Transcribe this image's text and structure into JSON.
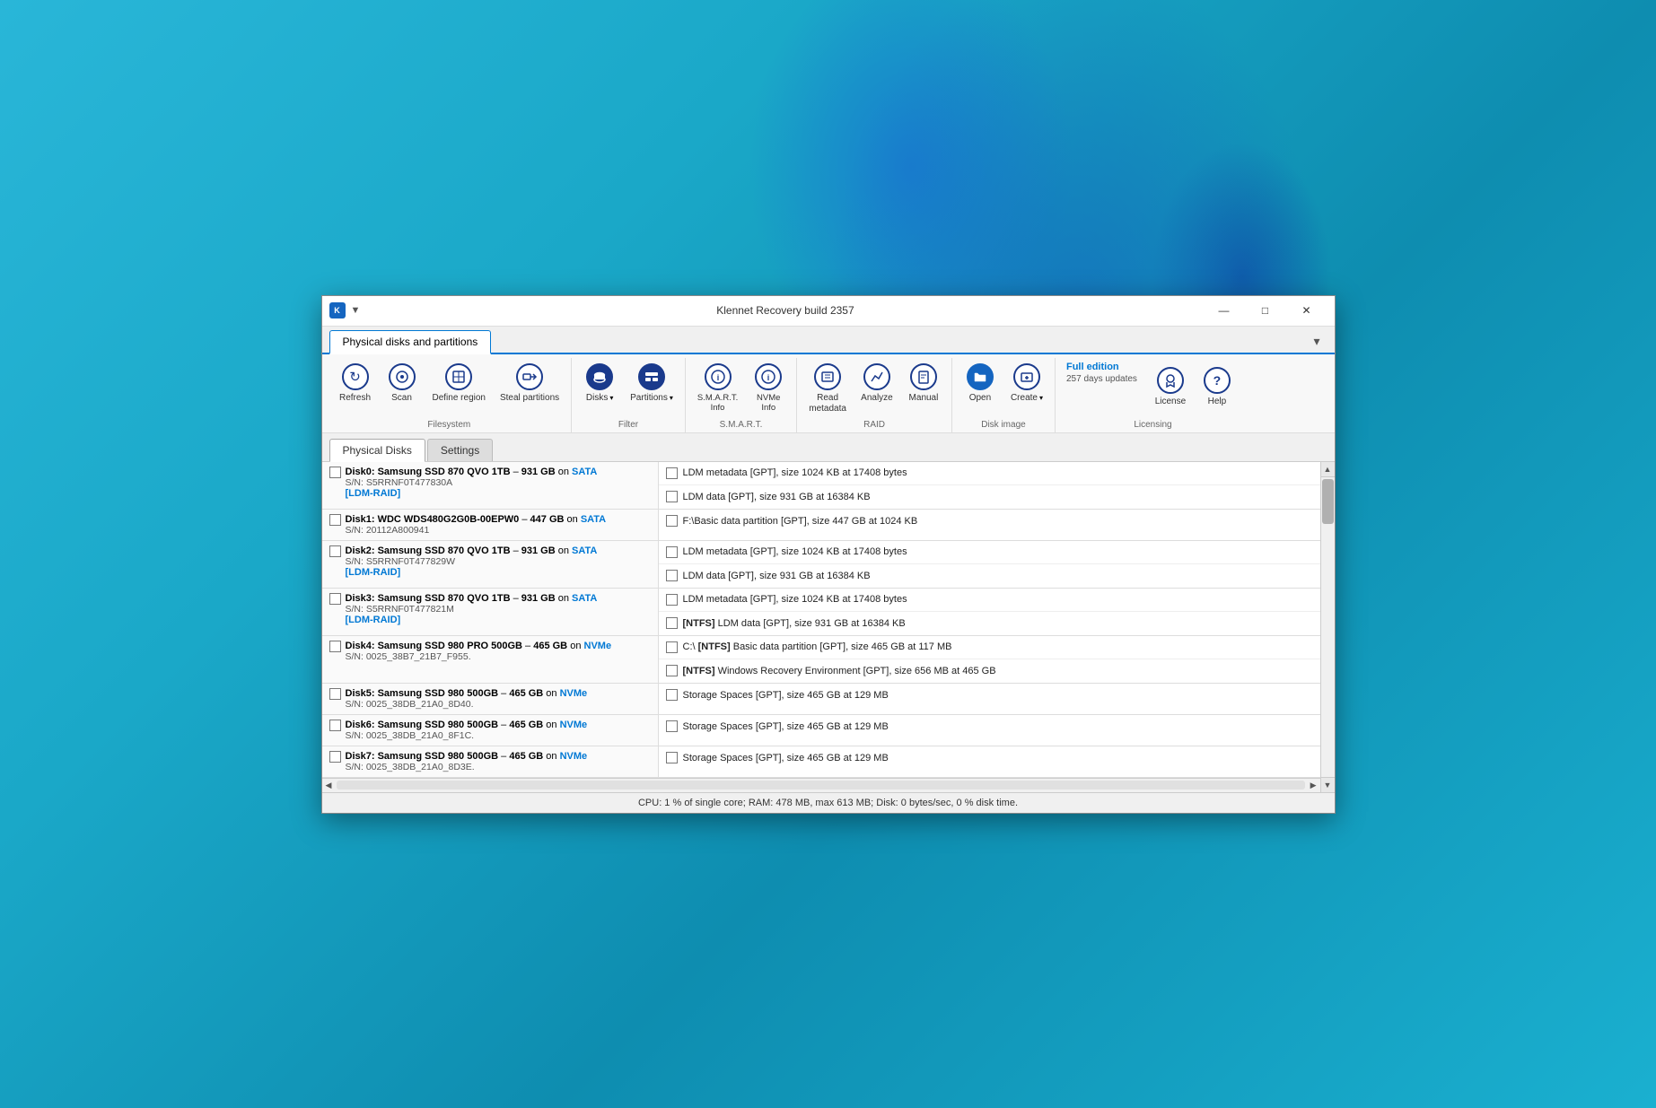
{
  "window": {
    "title": "Klennet Recovery build 2357",
    "icon": "K",
    "pin": "▼"
  },
  "tabs": [
    {
      "id": "main-tab",
      "label": "Physical disks and partitions",
      "active": true
    }
  ],
  "ribbon": {
    "groups": [
      {
        "id": "filesystem",
        "label": "Filesystem",
        "items": [
          {
            "id": "refresh",
            "label": "Refresh",
            "icon": "refresh"
          },
          {
            "id": "scan",
            "label": "Scan",
            "icon": "scan"
          },
          {
            "id": "define-region",
            "label": "Define region",
            "icon": "define"
          },
          {
            "id": "steal-partitions",
            "label": "Steal partitions",
            "icon": "steal"
          }
        ]
      },
      {
        "id": "filter",
        "label": "Filter",
        "items": [
          {
            "id": "disks",
            "label": "Disks",
            "icon": "disks",
            "has_arrow": true
          },
          {
            "id": "partitions",
            "label": "Partitions",
            "icon": "partitions",
            "has_arrow": true
          }
        ]
      },
      {
        "id": "smart",
        "label": "S.M.A.R.T.",
        "items": [
          {
            "id": "smart-info",
            "label": "S.M.A.R.T. Info",
            "icon": "smart"
          },
          {
            "id": "nvme-info",
            "label": "NVMe Info",
            "icon": "nvme"
          }
        ]
      },
      {
        "id": "raid",
        "label": "RAID",
        "items": [
          {
            "id": "read-metadata",
            "label": "Read metadata",
            "icon": "read"
          },
          {
            "id": "analyze",
            "label": "Analyze",
            "icon": "analyze"
          },
          {
            "id": "manual",
            "label": "Manual",
            "icon": "manual"
          }
        ]
      },
      {
        "id": "disk-image",
        "label": "Disk image",
        "items": [
          {
            "id": "open",
            "label": "Open",
            "icon": "open"
          },
          {
            "id": "create",
            "label": "Create",
            "icon": "create",
            "has_arrow": true
          }
        ]
      },
      {
        "id": "licensing",
        "label": "Licensing",
        "full_edition": "Full edition",
        "days_updates": "257 days updates",
        "items": [
          {
            "id": "license",
            "label": "License",
            "icon": "license"
          },
          {
            "id": "help",
            "label": "Help",
            "icon": "help"
          }
        ]
      }
    ]
  },
  "inner_tabs": [
    {
      "id": "physical-disks",
      "label": "Physical Disks",
      "active": true
    },
    {
      "id": "settings",
      "label": "Settings",
      "active": false
    }
  ],
  "disks": [
    {
      "id": "disk0",
      "name": "Disk0:",
      "model": "Samsung SSD 870 QVO 1TB",
      "size": "931 GB",
      "interface": "SATA",
      "serial": "S/N: S5RRNF0T477830A",
      "tag": "[LDM-RAID]",
      "partitions": [
        {
          "label": "LDM metadata [GPT], size 1024 KB at 17408 bytes"
        },
        {
          "label": "LDM data [GPT], size 931 GB at 16384 KB"
        }
      ]
    },
    {
      "id": "disk1",
      "name": "Disk1:",
      "model": "WDC WDS480G2G0B-00EPW0",
      "size": "447 GB",
      "interface": "SATA",
      "serial": "S/N: 20112A800941",
      "tag": "",
      "partitions": [
        {
          "label": "F:\\Basic data partition [GPT], size 447 GB at 1024 KB"
        }
      ]
    },
    {
      "id": "disk2",
      "name": "Disk2:",
      "model": "Samsung SSD 870 QVO 1TB",
      "size": "931 GB",
      "interface": "SATA",
      "serial": "S/N: S5RRNF0T477829W",
      "tag": "[LDM-RAID]",
      "partitions": [
        {
          "label": "LDM metadata [GPT], size 1024 KB at 17408 bytes"
        },
        {
          "label": "LDM data [GPT], size 931 GB at 16384 KB"
        }
      ]
    },
    {
      "id": "disk3",
      "name": "Disk3:",
      "model": "Samsung SSD 870 QVO 1TB",
      "size": "931 GB",
      "interface": "SATA",
      "serial": "S/N: S5RRNF0T477821M",
      "tag": "[LDM-RAID]",
      "partitions": [
        {
          "label": "LDM metadata [GPT], size 1024 KB at 17408 bytes"
        },
        {
          "label": "[NTFS] LDM data [GPT], size 931 GB at 16384 KB",
          "ntfs": true
        }
      ]
    },
    {
      "id": "disk4",
      "name": "Disk4:",
      "model": "Samsung SSD 980 PRO 500GB",
      "size": "465 GB",
      "interface": "NVMe",
      "serial": "S/N: 0025_38B7_21B7_F955.",
      "tag": "",
      "partitions": [
        {
          "label": "C:\\ [NTFS] Basic data partition [GPT], size 465 GB at 117 MB",
          "ntfs": true
        },
        {
          "label": "[NTFS] Windows Recovery Environment [GPT], size 656 MB at 465 GB",
          "ntfs": true
        }
      ]
    },
    {
      "id": "disk5",
      "name": "Disk5:",
      "model": "Samsung SSD 980 500GB",
      "size": "465 GB",
      "interface": "NVMe",
      "serial": "S/N: 0025_38DB_21A0_8D40.",
      "tag": "",
      "partitions": [
        {
          "label": "Storage Spaces [GPT], size 465 GB at 129 MB"
        }
      ]
    },
    {
      "id": "disk6",
      "name": "Disk6:",
      "model": "Samsung SSD 980 500GB",
      "size": "465 GB",
      "interface": "NVMe",
      "serial": "S/N: 0025_38DB_21A0_8F1C.",
      "tag": "",
      "partitions": [
        {
          "label": "Storage Spaces [GPT], size 465 GB at 129 MB"
        }
      ]
    },
    {
      "id": "disk7",
      "name": "Disk7:",
      "model": "Samsung SSD 980 500GB",
      "size": "465 GB",
      "interface": "NVMe",
      "serial": "S/N: 0025_38DB_21A0_8D3E.",
      "tag": "",
      "partitions": [
        {
          "label": "Storage Spaces [GPT], size 465 GB at 129 MB"
        }
      ]
    }
  ],
  "statusbar": {
    "text": "CPU: 1 % of single core; RAM: 478 MB, max 613 MB; Disk: 0 bytes/sec, 0 % disk time."
  },
  "titlebar_controls": {
    "minimize": "—",
    "maximize": "□",
    "close": "✕"
  }
}
